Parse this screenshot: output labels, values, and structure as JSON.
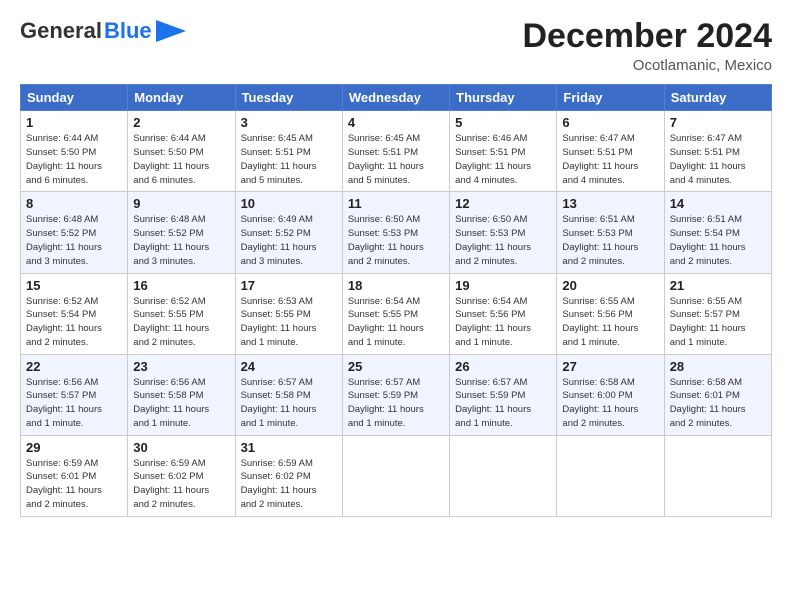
{
  "header": {
    "logo_general": "General",
    "logo_blue": "Blue",
    "month_title": "December 2024",
    "location": "Ocotlamanic, Mexico"
  },
  "weekdays": [
    "Sunday",
    "Monday",
    "Tuesday",
    "Wednesday",
    "Thursday",
    "Friday",
    "Saturday"
  ],
  "weeks": [
    [
      {
        "day": "1",
        "info": "Sunrise: 6:44 AM\nSunset: 5:50 PM\nDaylight: 11 hours\nand 6 minutes."
      },
      {
        "day": "2",
        "info": "Sunrise: 6:44 AM\nSunset: 5:50 PM\nDaylight: 11 hours\nand 6 minutes."
      },
      {
        "day": "3",
        "info": "Sunrise: 6:45 AM\nSunset: 5:51 PM\nDaylight: 11 hours\nand 5 minutes."
      },
      {
        "day": "4",
        "info": "Sunrise: 6:45 AM\nSunset: 5:51 PM\nDaylight: 11 hours\nand 5 minutes."
      },
      {
        "day": "5",
        "info": "Sunrise: 6:46 AM\nSunset: 5:51 PM\nDaylight: 11 hours\nand 4 minutes."
      },
      {
        "day": "6",
        "info": "Sunrise: 6:47 AM\nSunset: 5:51 PM\nDaylight: 11 hours\nand 4 minutes."
      },
      {
        "day": "7",
        "info": "Sunrise: 6:47 AM\nSunset: 5:51 PM\nDaylight: 11 hours\nand 4 minutes."
      }
    ],
    [
      {
        "day": "8",
        "info": "Sunrise: 6:48 AM\nSunset: 5:52 PM\nDaylight: 11 hours\nand 3 minutes."
      },
      {
        "day": "9",
        "info": "Sunrise: 6:48 AM\nSunset: 5:52 PM\nDaylight: 11 hours\nand 3 minutes."
      },
      {
        "day": "10",
        "info": "Sunrise: 6:49 AM\nSunset: 5:52 PM\nDaylight: 11 hours\nand 3 minutes."
      },
      {
        "day": "11",
        "info": "Sunrise: 6:50 AM\nSunset: 5:53 PM\nDaylight: 11 hours\nand 2 minutes."
      },
      {
        "day": "12",
        "info": "Sunrise: 6:50 AM\nSunset: 5:53 PM\nDaylight: 11 hours\nand 2 minutes."
      },
      {
        "day": "13",
        "info": "Sunrise: 6:51 AM\nSunset: 5:53 PM\nDaylight: 11 hours\nand 2 minutes."
      },
      {
        "day": "14",
        "info": "Sunrise: 6:51 AM\nSunset: 5:54 PM\nDaylight: 11 hours\nand 2 minutes."
      }
    ],
    [
      {
        "day": "15",
        "info": "Sunrise: 6:52 AM\nSunset: 5:54 PM\nDaylight: 11 hours\nand 2 minutes."
      },
      {
        "day": "16",
        "info": "Sunrise: 6:52 AM\nSunset: 5:55 PM\nDaylight: 11 hours\nand 2 minutes."
      },
      {
        "day": "17",
        "info": "Sunrise: 6:53 AM\nSunset: 5:55 PM\nDaylight: 11 hours\nand 1 minute."
      },
      {
        "day": "18",
        "info": "Sunrise: 6:54 AM\nSunset: 5:55 PM\nDaylight: 11 hours\nand 1 minute."
      },
      {
        "day": "19",
        "info": "Sunrise: 6:54 AM\nSunset: 5:56 PM\nDaylight: 11 hours\nand 1 minute."
      },
      {
        "day": "20",
        "info": "Sunrise: 6:55 AM\nSunset: 5:56 PM\nDaylight: 11 hours\nand 1 minute."
      },
      {
        "day": "21",
        "info": "Sunrise: 6:55 AM\nSunset: 5:57 PM\nDaylight: 11 hours\nand 1 minute."
      }
    ],
    [
      {
        "day": "22",
        "info": "Sunrise: 6:56 AM\nSunset: 5:57 PM\nDaylight: 11 hours\nand 1 minute."
      },
      {
        "day": "23",
        "info": "Sunrise: 6:56 AM\nSunset: 5:58 PM\nDaylight: 11 hours\nand 1 minute."
      },
      {
        "day": "24",
        "info": "Sunrise: 6:57 AM\nSunset: 5:58 PM\nDaylight: 11 hours\nand 1 minute."
      },
      {
        "day": "25",
        "info": "Sunrise: 6:57 AM\nSunset: 5:59 PM\nDaylight: 11 hours\nand 1 minute."
      },
      {
        "day": "26",
        "info": "Sunrise: 6:57 AM\nSunset: 5:59 PM\nDaylight: 11 hours\nand 1 minute."
      },
      {
        "day": "27",
        "info": "Sunrise: 6:58 AM\nSunset: 6:00 PM\nDaylight: 11 hours\nand 2 minutes."
      },
      {
        "day": "28",
        "info": "Sunrise: 6:58 AM\nSunset: 6:01 PM\nDaylight: 11 hours\nand 2 minutes."
      }
    ],
    [
      {
        "day": "29",
        "info": "Sunrise: 6:59 AM\nSunset: 6:01 PM\nDaylight: 11 hours\nand 2 minutes."
      },
      {
        "day": "30",
        "info": "Sunrise: 6:59 AM\nSunset: 6:02 PM\nDaylight: 11 hours\nand 2 minutes."
      },
      {
        "day": "31",
        "info": "Sunrise: 6:59 AM\nSunset: 6:02 PM\nDaylight: 11 hours\nand 2 minutes."
      },
      {
        "day": "",
        "info": ""
      },
      {
        "day": "",
        "info": ""
      },
      {
        "day": "",
        "info": ""
      },
      {
        "day": "",
        "info": ""
      }
    ]
  ]
}
